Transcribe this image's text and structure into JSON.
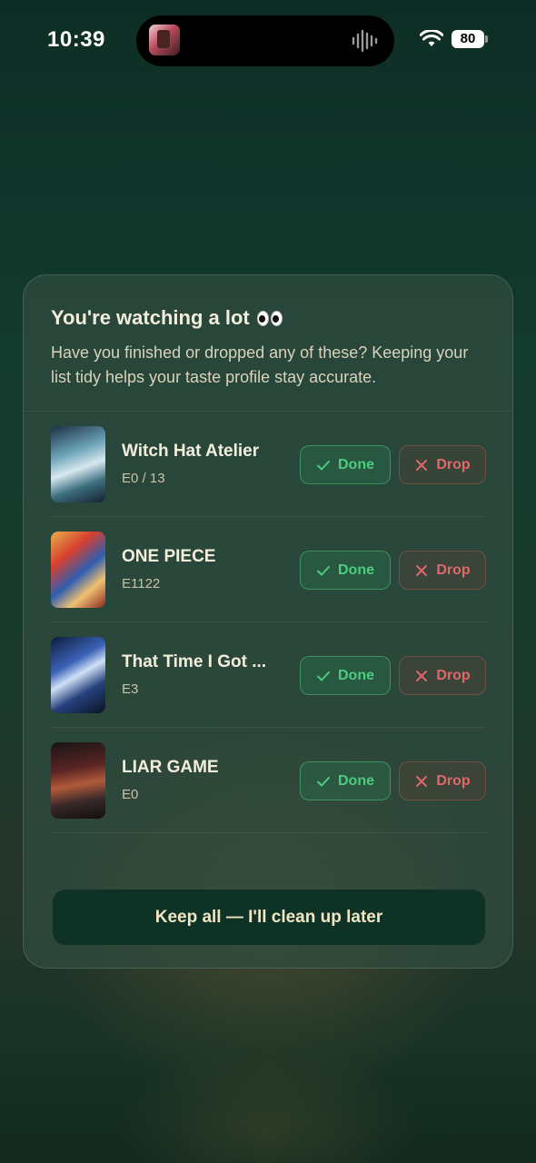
{
  "status_bar": {
    "time": "10:39",
    "battery": "80"
  },
  "modal": {
    "title": "You're watching a lot",
    "title_emoji_icon": "eyes-icon",
    "description": "Have you finished or dropped any of these? Keeping your list tidy helps your taste profile stay accurate.",
    "done_label": "Done",
    "drop_label": "Drop",
    "items": [
      {
        "title": "Witch Hat Atelier",
        "episode": "E0 / 13"
      },
      {
        "title": "ONE PIECE",
        "episode": "E1122"
      },
      {
        "title": "That Time I Got ...",
        "episode": "E3"
      },
      {
        "title": "LIAR GAME",
        "episode": "E0"
      }
    ],
    "keep_all_label": "Keep all — I'll clean up later"
  },
  "colors": {
    "done_green": "#4ecb7f",
    "drop_red": "#e0686a",
    "primary_button": "#0e3226"
  }
}
